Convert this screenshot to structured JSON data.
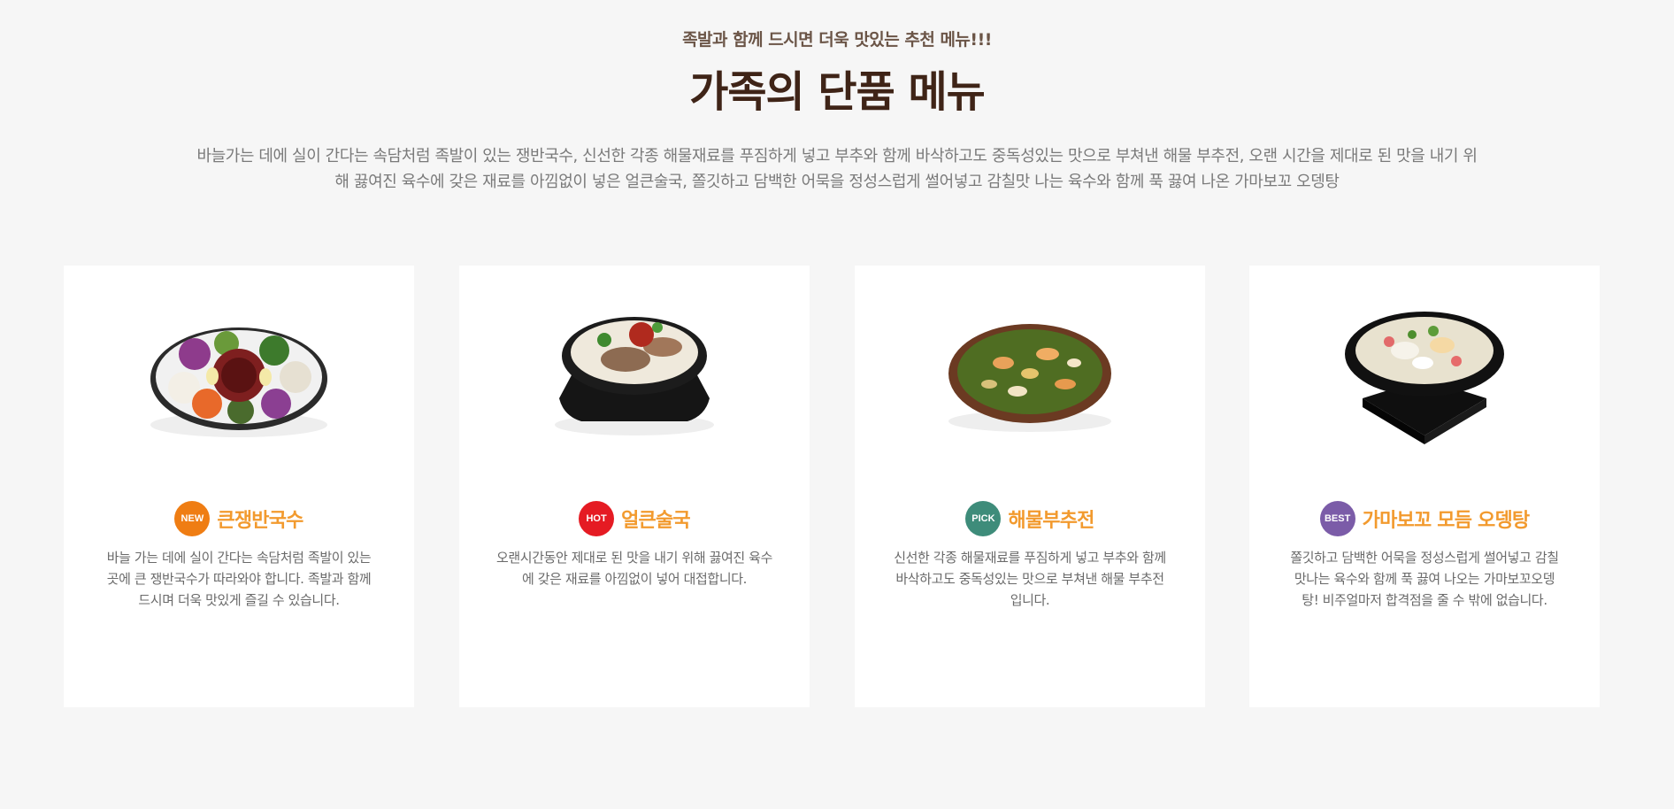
{
  "header": {
    "subtitle": "족발과 함께 드시면 더욱 맛있는 추천 메뉴!!!",
    "title": "가족의 단품 메뉴",
    "intro": "바늘가는 데에 실이 간다는 속담처럼 족발이 있는 쟁반국수, 신선한 각종 해물재료를 푸짐하게 넣고 부추와 함께 바삭하고도 중독성있는 맛으로 부쳐낸 해물 부추전, 오랜 시간을 제대로 된 맛을 내기 위해 끓여진 육수에 갖은 재료를 아낌없이 넣은 얼큰술국, 쫄깃하고 담백한 어묵을 정성스럽게 썰어넣고 감칠맛 나는 육수와 함께 푹 끓여 나온 가마보꼬 오뎅탕"
  },
  "menu": [
    {
      "badge": "NEW",
      "badge_color": "#ef7d13",
      "name": "큰쟁반국수",
      "description": "바늘 가는 데에 실이 간다는 속담처럼 족발이 있는 곳에 큰 쟁반국수가 따라와야 합니다. 족발과 함께 드시며 더욱 맛있게 즐길 수 있습니다.",
      "image": "noodle-platter-image"
    },
    {
      "badge": "HOT",
      "badge_color": "#e51b23",
      "name": "얼큰술국",
      "description": "오랜시간동안 제대로 된 맛을 내기 위해 끓여진 육수에 갖은 재료를 아낌없이 넣어 대접합니다.",
      "image": "soup-pot-image"
    },
    {
      "badge": "PICK",
      "badge_color": "#3e8c7a",
      "name": "해물부추전",
      "description": "신선한 각종 해물재료를 푸짐하게 넣고 부추와 함께 바삭하고도 중독성있는 맛으로 부쳐낸 해물 부추전입니다.",
      "image": "seafood-pancake-image"
    },
    {
      "badge": "BEST",
      "badge_color": "#7b5ca8",
      "name": "가마보꼬 모듬 오뎅탕",
      "description": "쫄깃하고 담백한 어묵을 정성스럽게 썰어넣고 감칠맛나는 육수와 함께 푹 끓여 나오는 가마보꼬오뎅탕! 비주얼마저 합격점을 줄 수 밖에 없습니다.",
      "image": "fishcake-stew-image"
    }
  ],
  "colors": {
    "background": "#f6f6f6",
    "title": "#3f2417",
    "dish_name": "#f29a2e"
  }
}
